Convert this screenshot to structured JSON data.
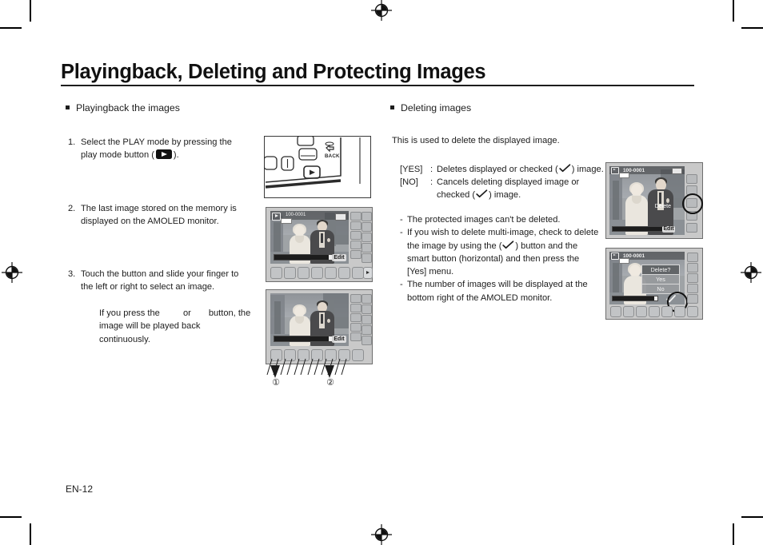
{
  "document": {
    "title": "Playingback, Deleting and Protecting Images",
    "page_number": "EN-12"
  },
  "left_column": {
    "section_title": "Playingback the images",
    "steps": [
      {
        "number": "1.",
        "text_before": "Select the PLAY mode by pressing the play mode button (",
        "icon": "play-mode-icon",
        "text_after": ")."
      },
      {
        "number": "2.",
        "text": "The last image stored on the memory is displayed on the AMOLED monitor."
      },
      {
        "number": "3.",
        "text": "Touch the button and slide your finger to the left or right to select an image."
      }
    ],
    "note_before": "If you press the",
    "note_middle": "or",
    "note_after": "button, the image",
    "note_second_line": "will be played back continuously."
  },
  "right_column": {
    "section_title": "Deleting images",
    "intro": "This is used to delete the displayed image.",
    "definitions": [
      {
        "key": "[YES]",
        "colon": ":",
        "text_before": "Deletes displayed or checked (",
        "icon": "check-icon",
        "text_after": ") image."
      },
      {
        "key": "[NO]",
        "colon": ":",
        "text_before": "Cancels deleting displayed image or",
        "icon": "check-icon",
        "text_after": ""
      }
    ],
    "definition_continuation_before": "checked (",
    "definition_continuation_after": ") image.",
    "notes": [
      "The protected images can't be deleted.",
      "If you wish to delete multi-image, check to delete",
      "smart button (horizontal) and then press the [Yes]",
      "menu.",
      "The number of images will be displayed at the",
      "bottom right of the AMOLED monitor."
    ],
    "note_line_with_icon_before": "the image by using the (",
    "note_line_with_icon_after": ") button and the"
  },
  "figures": {
    "camera_back": {
      "name": "camera-back-illustration",
      "back_label": "BACK"
    },
    "lcd_playback": {
      "name": "lcd-playback-illustration",
      "file_label": "100-0001",
      "edit_label": "Edit"
    },
    "lcd_slider": {
      "name": "lcd-slider-illustration",
      "edit_label": "Edit",
      "callout_1": "①",
      "callout_2": "②"
    },
    "lcd_delete": {
      "name": "lcd-delete-illustration",
      "file_label": "100-0001",
      "delete_label": "Delete",
      "edit_label": "Edit"
    },
    "lcd_delete_dialog": {
      "name": "lcd-delete-dialog-illustration",
      "file_label": "100-0001",
      "prompt": "Delete?",
      "yes_label": "Yes",
      "no_label": "No"
    }
  },
  "colors": {
    "text": "#1d1d1d",
    "rule": "#1d1d1d",
    "lcd_frame": "#c9c9c9"
  }
}
